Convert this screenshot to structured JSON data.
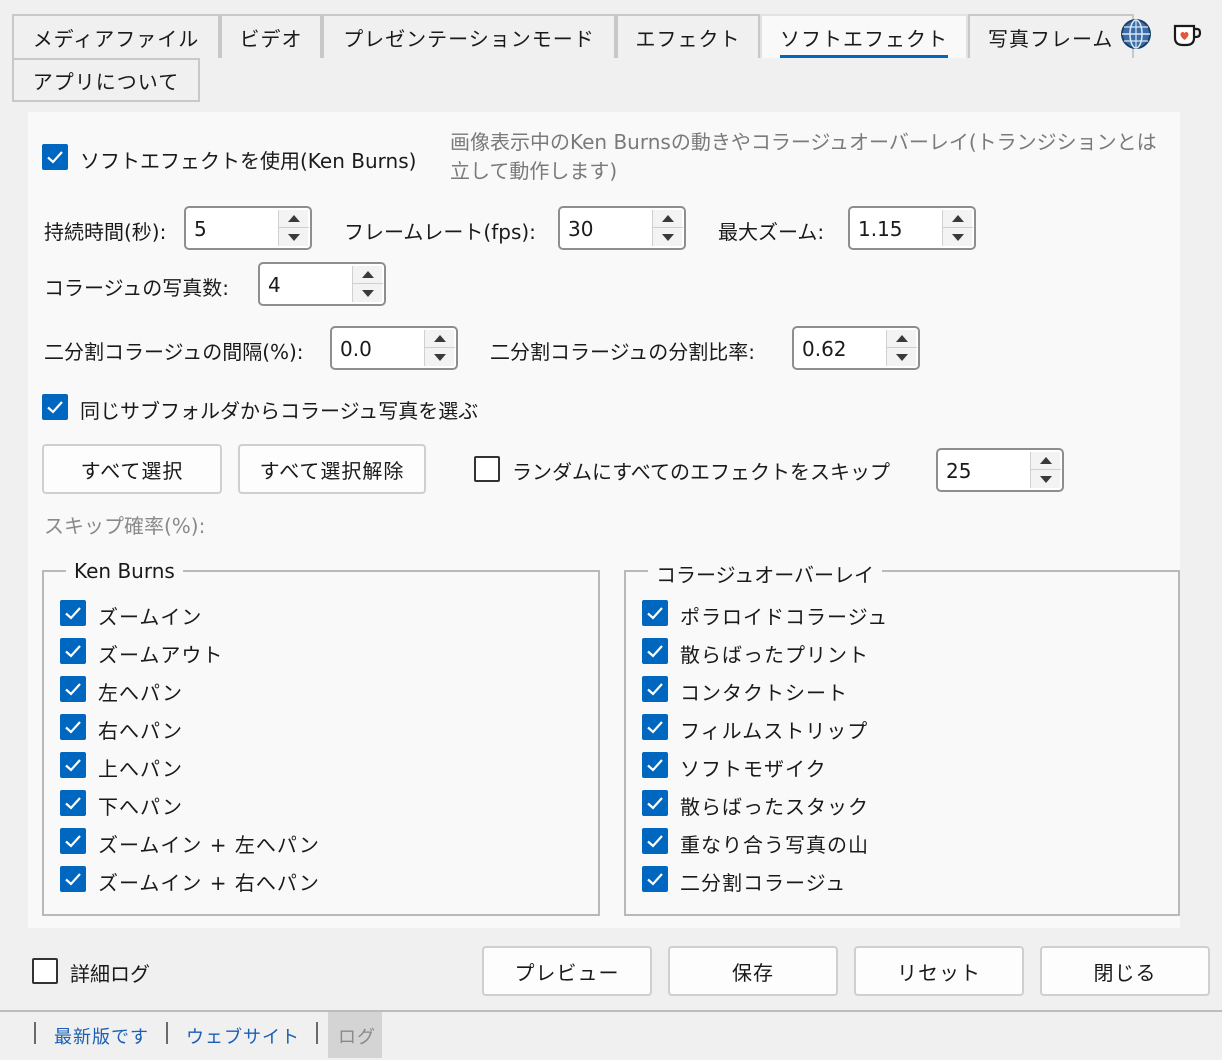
{
  "tabs": [
    "メディアファイル",
    "ビデオ",
    "プレゼンテーションモード",
    "エフェクト",
    "ソフトエフェクト",
    "写真フレーム",
    "アプリについて"
  ],
  "active_tab": "ソフトエフェクト",
  "icons": [
    "globe-icon",
    "coffee-cup-icon",
    "checkmark-icon",
    "spin-up-icon",
    "spin-down-icon"
  ],
  "colors": {
    "accent": "#0067c0",
    "link": "#1a5fb4"
  },
  "soft_effect": {
    "enable_label": "ソフトエフェクトを使用(Ken Burns)",
    "enable_checked": true,
    "description_line1": "画像表示中のKen Burnsの動きやコラージュオーバーレイ(トランジションとは",
    "description_line2": "立して動作します)"
  },
  "params": {
    "duration_label": "持続時間(秒):",
    "duration_value": "5",
    "framerate_label": "フレームレート(fps):",
    "framerate_value": "30",
    "maxzoom_label": "最大ズーム:",
    "maxzoom_value": "1.15",
    "collage_count_label": "コラージュの写真数:",
    "collage_count_value": "4",
    "split_gap_label": "二分割コラージュの間隔(%):",
    "split_gap_value": "0.0",
    "split_ratio_label": "二分割コラージュの分割比率:",
    "split_ratio_value": "0.62"
  },
  "same_subfolder": {
    "label": "同じサブフォルダからコラージュ写真を選ぶ",
    "checked": true
  },
  "buttons": {
    "select_all": "すべて選択",
    "deselect_all": "すべて選択解除"
  },
  "random_skip": {
    "label": "ランダムにすべてのエフェクトをスキップ",
    "checked": false,
    "value": "25"
  },
  "skip_rate_label": "スキップ確率(%):",
  "ken_burns": {
    "title": "Ken Burns",
    "items": [
      "ズームイン",
      "ズームアウト",
      "左へパン",
      "右へパン",
      "上へパン",
      "下へパン",
      "ズームイン + 左へパン",
      "ズームイン + 右へパン"
    ]
  },
  "collage": {
    "title": "コラージュオーバーレイ",
    "items": [
      "ポラロイドコラージュ",
      "散らばったプリント",
      "コンタクトシート",
      "フィルムストリップ",
      "ソフトモザイク",
      "散らばったスタック",
      "重なり合う写真の山",
      "二分割コラージュ"
    ]
  },
  "bottom": {
    "verbose_log_label": "詳細ログ",
    "verbose_log_checked": false,
    "preview": "プレビュー",
    "save": "保存",
    "reset": "リセット",
    "close": "閉じる"
  },
  "status": {
    "version": "最新版です",
    "website": "ウェブサイト",
    "log": "ログ"
  }
}
